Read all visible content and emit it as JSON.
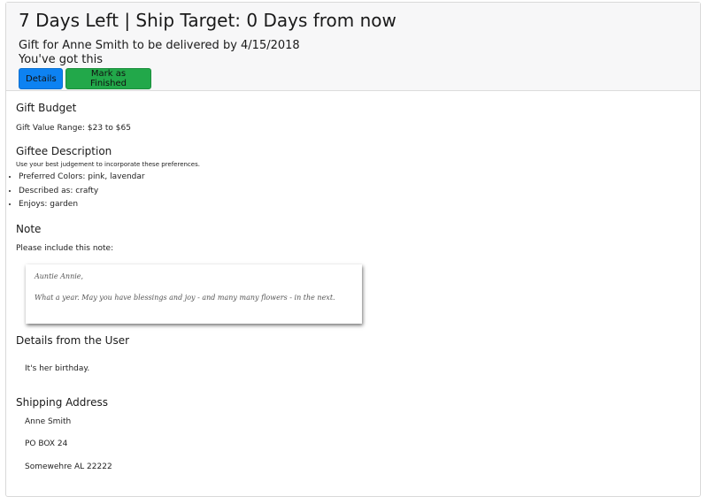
{
  "header": {
    "title": "7 Days Left | Ship Target: 0 Days from now",
    "subtitle": "Gift for Anne Smith to be delivered by 4/15/2018",
    "tagline": "You've got this",
    "details_button": "Details",
    "finish_button": "Mark as Finished"
  },
  "budget": {
    "heading": "Gift Budget",
    "range": "Gift Value Range: $23 to $65"
  },
  "giftee": {
    "heading": "Giftee Description",
    "hint": "Use your best judgement to incorporate these preferences.",
    "preferences": [
      "Preferred Colors: pink, lavendar",
      "Described as: crafty",
      "Enjoys: garden"
    ]
  },
  "note": {
    "heading": "Note",
    "intro": "Please include this note:",
    "greeting": "Auntie Annie,",
    "message": "What a year. May you have blessings and joy - and many many flowers - in the next."
  },
  "user_details": {
    "heading": "Details from the User",
    "text": "It's her birthday."
  },
  "shipping": {
    "heading": "Shipping Address",
    "name": "Anne Smith",
    "line1": "PO BOX 24",
    "line2": "Somewehre AL 22222"
  },
  "colors": {
    "primary": "#0d82f2",
    "success": "#22a84a",
    "header_bg": "#f7f7f8"
  }
}
